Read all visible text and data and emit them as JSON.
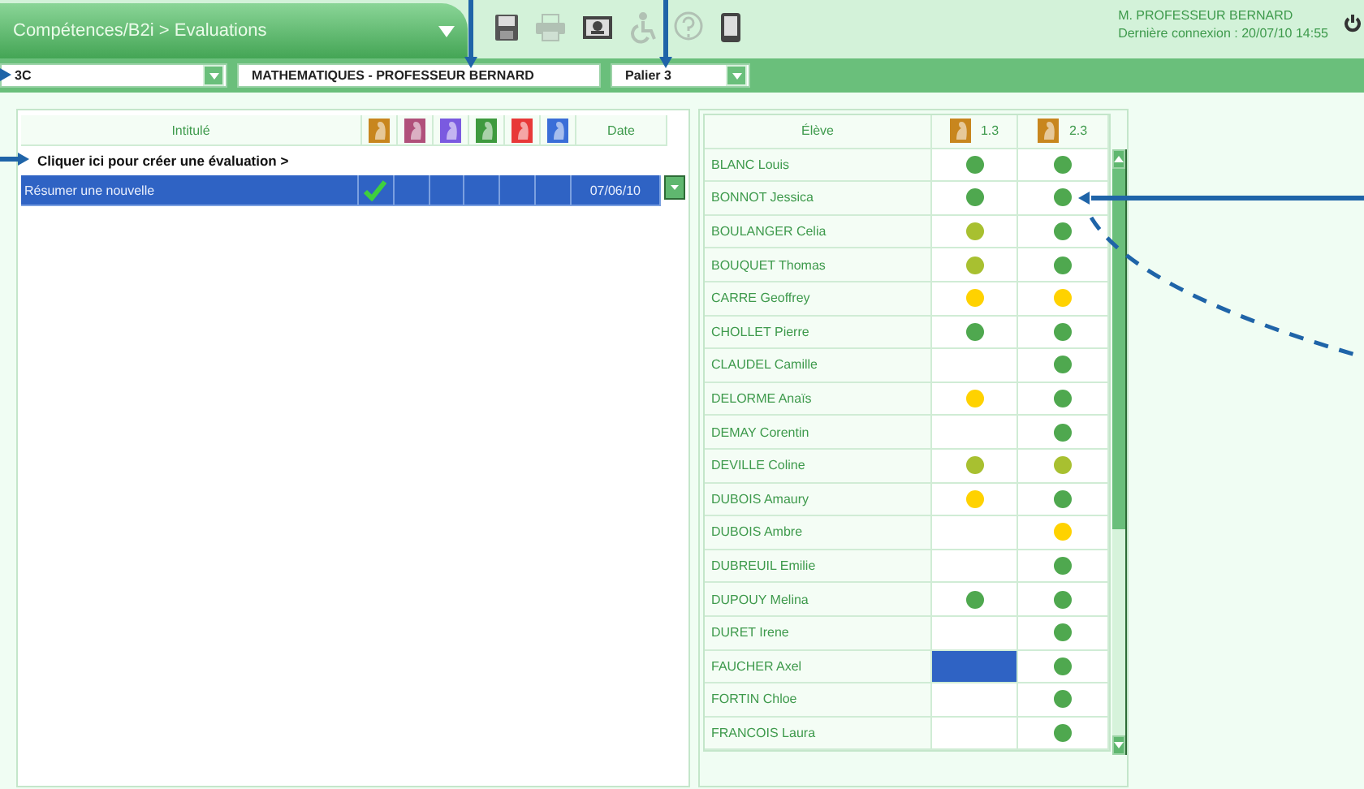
{
  "header": {
    "breadcrumb": "Compétences/B2i > Evaluations",
    "user": "M. PROFESSEUR BERNARD",
    "last_login": "Dernière connexion : 20/07/10 14:55"
  },
  "toolbar": [
    {
      "kind": "save",
      "disabled": false
    },
    {
      "kind": "print",
      "disabled": true
    },
    {
      "kind": "card",
      "disabled": false
    },
    {
      "kind": "access",
      "disabled": true
    },
    {
      "kind": "help",
      "disabled": true
    },
    {
      "kind": "device",
      "disabled": false
    }
  ],
  "filters": {
    "class": "3C",
    "subject": "MATHEMATIQUES - PROFESSEUR BERNARD",
    "level": "Palier 3"
  },
  "evaluations": {
    "columns": {
      "title": "Intitulé",
      "date": "Date"
    },
    "icon_columns": [
      {
        "color": "#c8861e"
      },
      {
        "color": "#b0507a"
      },
      {
        "color": "#7a5ae0"
      },
      {
        "color": "#3e9a3e"
      },
      {
        "color": "#e83838"
      },
      {
        "color": "#3a6ed8"
      }
    ],
    "create_link": "Cliquer ici pour créer une évaluation >",
    "rows": [
      {
        "title": "Résumer une nouvelle",
        "date": "07/06/10",
        "selected": true,
        "marks": [
          {
            "checked": true
          },
          {
            "checked": false
          },
          {
            "checked": false
          },
          {
            "checked": false
          },
          {
            "checked": false
          },
          {
            "checked": false
          }
        ]
      }
    ]
  },
  "students": {
    "header": "Élève",
    "columns": [
      {
        "label": "1.3"
      },
      {
        "label": "2.3"
      }
    ],
    "rows": [
      {
        "name": "BLANC Louis",
        "cells": [
          {
            "kind": "dot",
            "color": "#4fa84f",
            "selected": false
          },
          {
            "kind": "dot",
            "color": "#4fa84f",
            "selected": false
          }
        ]
      },
      {
        "name": "BONNOT Jessica",
        "cells": [
          {
            "kind": "dot",
            "color": "#4fa84f",
            "selected": false
          },
          {
            "kind": "dot",
            "color": "#4fa84f",
            "selected": false
          }
        ]
      },
      {
        "name": "BOULANGER Celia",
        "cells": [
          {
            "kind": "dot",
            "color": "#a8c030",
            "selected": false
          },
          {
            "kind": "dot",
            "color": "#4fa84f",
            "selected": false
          }
        ]
      },
      {
        "name": "BOUQUET Thomas",
        "cells": [
          {
            "kind": "dot",
            "color": "#a8c030",
            "selected": false
          },
          {
            "kind": "dot",
            "color": "#4fa84f",
            "selected": false
          }
        ]
      },
      {
        "name": "CARRE Geoffrey",
        "cells": [
          {
            "kind": "dot",
            "color": "#ffd200",
            "selected": false
          },
          {
            "kind": "dot",
            "color": "#ffd200",
            "selected": false
          }
        ]
      },
      {
        "name": "CHOLLET Pierre",
        "cells": [
          {
            "kind": "dot",
            "color": "#4fa84f",
            "selected": false
          },
          {
            "kind": "dot",
            "color": "#4fa84f",
            "selected": false
          }
        ]
      },
      {
        "name": "CLAUDEL Camille",
        "cells": [
          {
            "kind": "empty",
            "selected": false
          },
          {
            "kind": "dot",
            "color": "#4fa84f",
            "selected": false
          }
        ]
      },
      {
        "name": "DELORME Anaïs",
        "cells": [
          {
            "kind": "dot",
            "color": "#ffd200",
            "selected": false
          },
          {
            "kind": "dot",
            "color": "#4fa84f",
            "selected": false
          }
        ]
      },
      {
        "name": "DEMAY Corentin",
        "cells": [
          {
            "kind": "empty",
            "selected": false
          },
          {
            "kind": "dot",
            "color": "#4fa84f",
            "selected": false
          }
        ]
      },
      {
        "name": "DEVILLE Coline",
        "cells": [
          {
            "kind": "dot",
            "color": "#a8c030",
            "selected": false
          },
          {
            "kind": "dot",
            "color": "#a8c030",
            "selected": false
          }
        ]
      },
      {
        "name": "DUBOIS Amaury",
        "cells": [
          {
            "kind": "dot",
            "color": "#ffd200",
            "selected": false
          },
          {
            "kind": "dot",
            "color": "#4fa84f",
            "selected": false
          }
        ]
      },
      {
        "name": "DUBOIS Ambre",
        "cells": [
          {
            "kind": "empty",
            "selected": false
          },
          {
            "kind": "dot",
            "color": "#ffd200",
            "selected": false
          }
        ]
      },
      {
        "name": "DUBREUIL Emilie",
        "cells": [
          {
            "kind": "empty",
            "selected": false
          },
          {
            "kind": "dot",
            "color": "#4fa84f",
            "selected": false
          }
        ]
      },
      {
        "name": "DUPOUY Melina",
        "cells": [
          {
            "kind": "dot",
            "color": "#4fa84f",
            "selected": false
          },
          {
            "kind": "dot",
            "color": "#4fa84f",
            "selected": false
          }
        ]
      },
      {
        "name": "DURET Irene",
        "cells": [
          {
            "kind": "empty",
            "selected": false
          },
          {
            "kind": "dot",
            "color": "#4fa84f",
            "selected": false
          }
        ]
      },
      {
        "name": "FAUCHER Axel",
        "cells": [
          {
            "kind": "empty",
            "selected": true
          },
          {
            "kind": "dot",
            "color": "#4fa84f",
            "selected": false
          }
        ]
      },
      {
        "name": "FORTIN Chloe",
        "cells": [
          {
            "kind": "empty",
            "selected": false
          },
          {
            "kind": "dot",
            "color": "#4fa84f",
            "selected": false
          }
        ]
      },
      {
        "name": "FRANCOIS Laura",
        "cells": [
          {
            "kind": "empty",
            "selected": false
          },
          {
            "kind": "dot",
            "color": "#4fa84f",
            "selected": false
          }
        ]
      }
    ]
  }
}
